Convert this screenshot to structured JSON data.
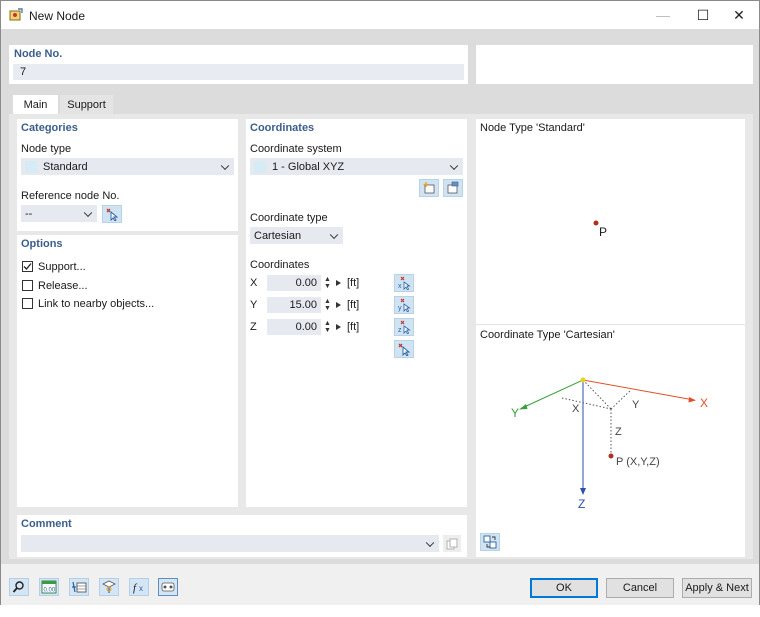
{
  "window": {
    "title": "New Node",
    "minimize": "—",
    "maximize": "☐",
    "close": "✕"
  },
  "node_no": {
    "label": "Node No.",
    "value": "7"
  },
  "tabs": [
    {
      "label": "Main"
    },
    {
      "label": "Support"
    }
  ],
  "categories": {
    "title": "Categories",
    "node_type_label": "Node type",
    "node_type_value": "Standard",
    "ref_node_label": "Reference node No.",
    "ref_node_value": "--"
  },
  "options": {
    "title": "Options",
    "items": [
      {
        "label": "Support...",
        "checked": true
      },
      {
        "label": "Release...",
        "checked": false
      },
      {
        "label": "Link to nearby objects...",
        "checked": false
      }
    ]
  },
  "coordinates": {
    "title": "Coordinates",
    "system_label": "Coordinate system",
    "system_value": "1 - Global XYZ",
    "type_label": "Coordinate type",
    "type_value": "Cartesian",
    "coords_label": "Coordinates",
    "rows": [
      {
        "axis": "X",
        "value": "0.00",
        "unit": "[ft]"
      },
      {
        "axis": "Y",
        "value": "15.00",
        "unit": "[ft]"
      },
      {
        "axis": "Z",
        "value": "0.00",
        "unit": "[ft]"
      }
    ]
  },
  "preview": {
    "node_type_title": "Node Type 'Standard'",
    "point_label": "P",
    "coord_type_title": "Coordinate Type 'Cartesian'",
    "axis_x": "X",
    "axis_y": "Y",
    "axis_z": "Z",
    "dim_x": "X",
    "dim_y": "Y",
    "dim_z": "Z",
    "point_xyz": "P (X,Y,Z)"
  },
  "comment": {
    "label": "Comment",
    "value": ""
  },
  "buttons": {
    "ok": "OK",
    "cancel": "Cancel",
    "apply_next": "Apply & Next"
  },
  "colors": {
    "section_title": "#3b5f8a",
    "axis_x": "#e0502a",
    "axis_y": "#3aa03a",
    "axis_z": "#2a4fb0",
    "point": "#b03020",
    "origin": "#e8d020"
  }
}
